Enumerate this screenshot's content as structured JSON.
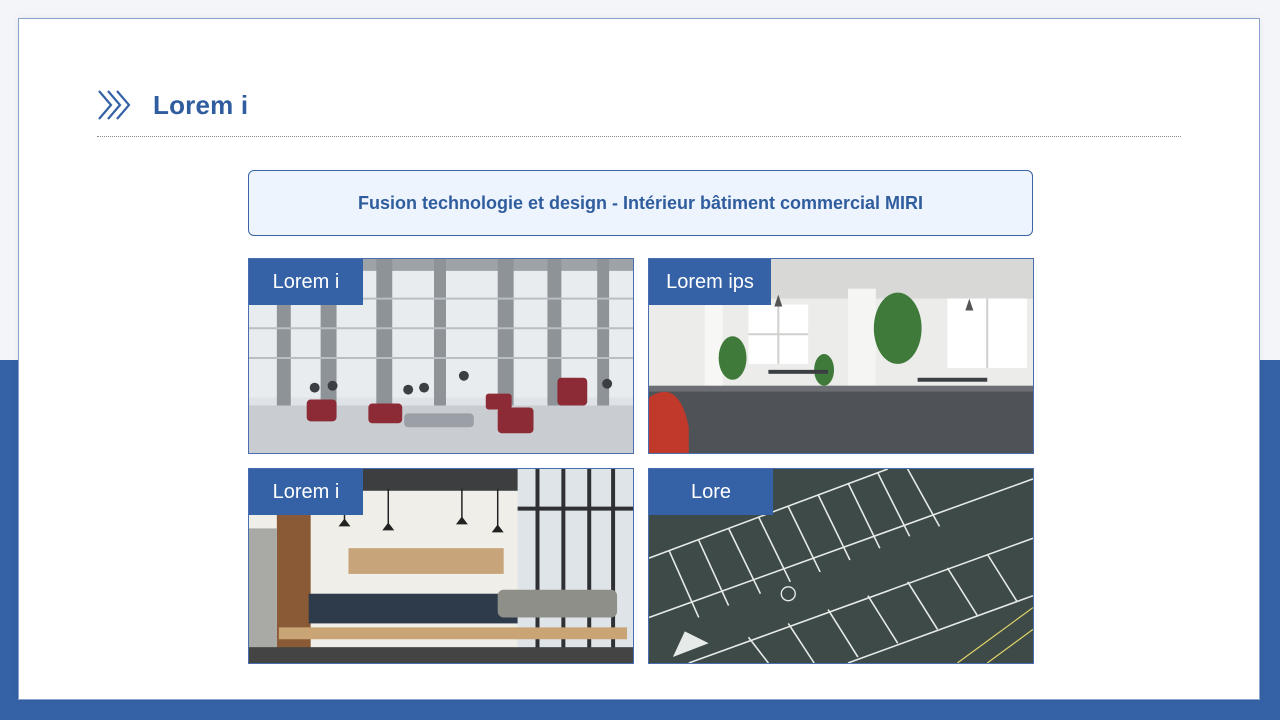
{
  "slide": {
    "title": "Lorem i",
    "icon": "double-chevron-right-icon",
    "accent_color": "#3562a6",
    "caption": "Fusion technologie et design - Intérieur bâtiment commercial MIRI",
    "cards": [
      {
        "label": "Lorem i",
        "image": "atrium-lounge-photo"
      },
      {
        "label": "Lorem ips",
        "image": "open-office-photo"
      },
      {
        "label": "Lorem i",
        "image": "cafeteria-photo"
      },
      {
        "label": "Lore",
        "image": "parking-lot-aerial-photo"
      }
    ]
  }
}
